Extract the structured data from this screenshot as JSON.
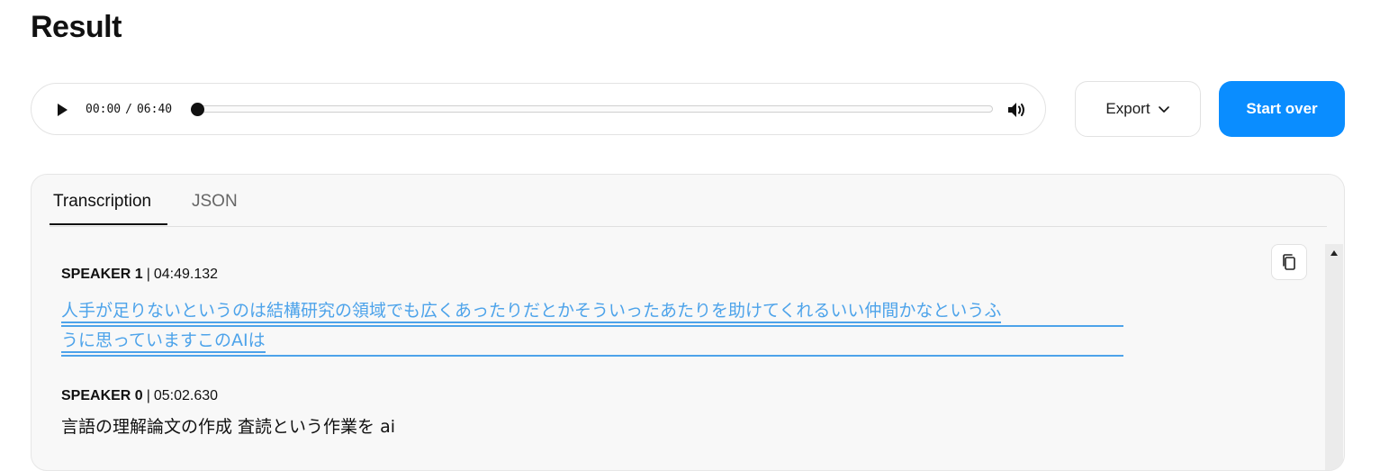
{
  "page": {
    "title": "Result"
  },
  "player": {
    "current_time": "00:00",
    "separator": "/",
    "duration": "06:40",
    "progress": 0,
    "icons": {
      "play": "play-icon",
      "volume": "volume-icon"
    }
  },
  "actions": {
    "export_label": "Export",
    "start_over_label": "Start over",
    "accent_color": "#0a8dff"
  },
  "tabs": [
    {
      "label": "Transcription",
      "active": true
    },
    {
      "label": "JSON",
      "active": false
    }
  ],
  "transcript": {
    "copy_icon": "copy-icon",
    "segments": [
      {
        "speaker": "SPEAKER 1",
        "separator": "|",
        "timestamp": "04:49.132",
        "active": true,
        "lines": [
          "人手が足りないというのは結構研究の領域でも広くあったりだとかそういったあたりを助けてくれるいい仲間かなというふ",
          "うに思っていますこのAIは"
        ]
      },
      {
        "speaker": "SPEAKER 0",
        "separator": "|",
        "timestamp": "05:02.630",
        "active": false,
        "lines": [
          "言語の理解論文の作成 査読という作業を ai"
        ]
      }
    ]
  }
}
